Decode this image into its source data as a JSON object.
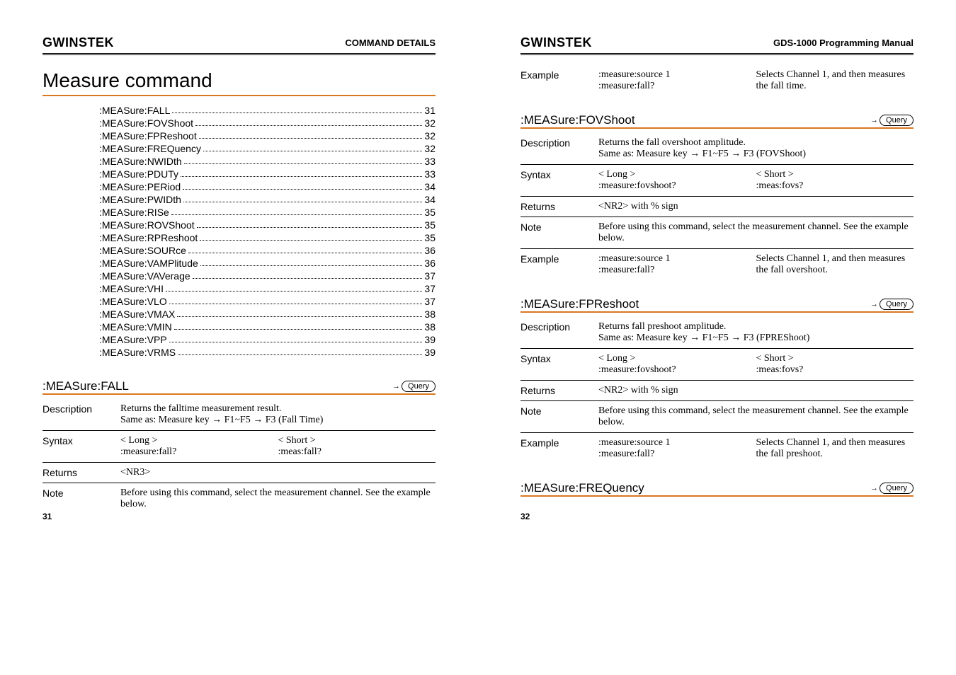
{
  "brand": "GWINSTEK",
  "left": {
    "headerTitle": "COMMAND DETAILS",
    "sectionTitle": "Measure command",
    "toc": [
      {
        "label": ":MEASure:FALL",
        "page": "31"
      },
      {
        "label": ":MEASure:FOVShoot",
        "page": "32"
      },
      {
        "label": ":MEASure:FPReshoot",
        "page": "32"
      },
      {
        "label": ":MEASure:FREQuency",
        "page": "32"
      },
      {
        "label": ":MEASure:NWIDth",
        "page": "33"
      },
      {
        "label": ":MEASure:PDUTy",
        "page": "33"
      },
      {
        "label": ":MEASure:PERiod",
        "page": "34"
      },
      {
        "label": ":MEASure:PWIDth",
        "page": "34"
      },
      {
        "label": ":MEASure:RISe",
        "page": "35"
      },
      {
        "label": ":MEASure:ROVShoot",
        "page": "35"
      },
      {
        "label": ":MEASure:RPReshoot",
        "page": "35"
      },
      {
        "label": ":MEASure:SOURce",
        "page": "36"
      },
      {
        "label": ":MEASure:VAMPlitude",
        "page": "36"
      },
      {
        "label": ":MEASure:VAVerage",
        "page": "37"
      },
      {
        "label": ":MEASure:VHI",
        "page": "37"
      },
      {
        "label": ":MEASure:VLO",
        "page": "37"
      },
      {
        "label": ":MEASure:VMAX",
        "page": "38"
      },
      {
        "label": ":MEASure:VMIN",
        "page": "38"
      },
      {
        "label": ":MEASure:VPP",
        "page": "39"
      },
      {
        "label": ":MEASure:VRMS",
        "page": "39"
      }
    ],
    "cmd": {
      "title": ":MEASure:FALL",
      "badge": "Query",
      "descLabel": "Description",
      "desc1": "Returns the falltime measurement result.",
      "desc2": "Same as: Measure key → F1~F5 → F3 (Fall Time)",
      "syntaxLabel": "Syntax",
      "longH": "< Long >",
      "shortH": "< Short >",
      "longV": ":measure:fall?",
      "shortV": ":meas:fall?",
      "returnsLabel": "Returns",
      "returnsV": "<NR3>",
      "noteLabel": "Note",
      "noteV": "Before using this command, select the measurement channel. See the example below."
    },
    "pageNum": "31"
  },
  "right": {
    "headerTitle": "GDS-1000 Programming Manual",
    "topExample": {
      "label": "Example",
      "c1a": ":measure:source 1",
      "c1b": ":measure:fall?",
      "c2": "Selects Channel 1, and then measures the fall time."
    },
    "cmd1": {
      "title": ":MEASure:FOVShoot",
      "badge": "Query",
      "descLabel": "Description",
      "desc1": "Returns the fall overshoot amplitude.",
      "desc2": "Same as: Measure key → F1~F5 → F3 (FOVShoot)",
      "syntaxLabel": "Syntax",
      "longH": "< Long >",
      "shortH": "< Short >",
      "longV": ":measure:fovshoot?",
      "shortV": ":meas:fovs?",
      "returnsLabel": "Returns",
      "returnsV": "<NR2> with % sign",
      "noteLabel": "Note",
      "noteV": "Before using this command, select the measurement channel. See the example below.",
      "exLabel": "Example",
      "exC1a": ":measure:source 1",
      "exC1b": ":measure:fall?",
      "exC2": "Selects Channel 1, and then measures the fall overshoot."
    },
    "cmd2": {
      "title": ":MEASure:FPReshoot",
      "badge": "Query",
      "descLabel": "Description",
      "desc1": "Returns fall preshoot amplitude.",
      "desc2": "Same as: Measure key → F1~F5 → F3 (FPREShoot)",
      "syntaxLabel": "Syntax",
      "longH": "< Long >",
      "shortH": "< Short >",
      "longV": ":measure:fovshoot?",
      "shortV": ":meas:fovs?",
      "returnsLabel": "Returns",
      "returnsV": "<NR2> with % sign",
      "noteLabel": "Note",
      "noteV": "Before using this command, select the measurement channel. See the example below.",
      "exLabel": "Example",
      "exC1a": ":measure:source 1",
      "exC1b": ":measure:fall?",
      "exC2": "Selects Channel 1, and then measures the fall preshoot."
    },
    "cmd3": {
      "title": ":MEASure:FREQuency",
      "badge": "Query"
    },
    "pageNum": "32"
  }
}
